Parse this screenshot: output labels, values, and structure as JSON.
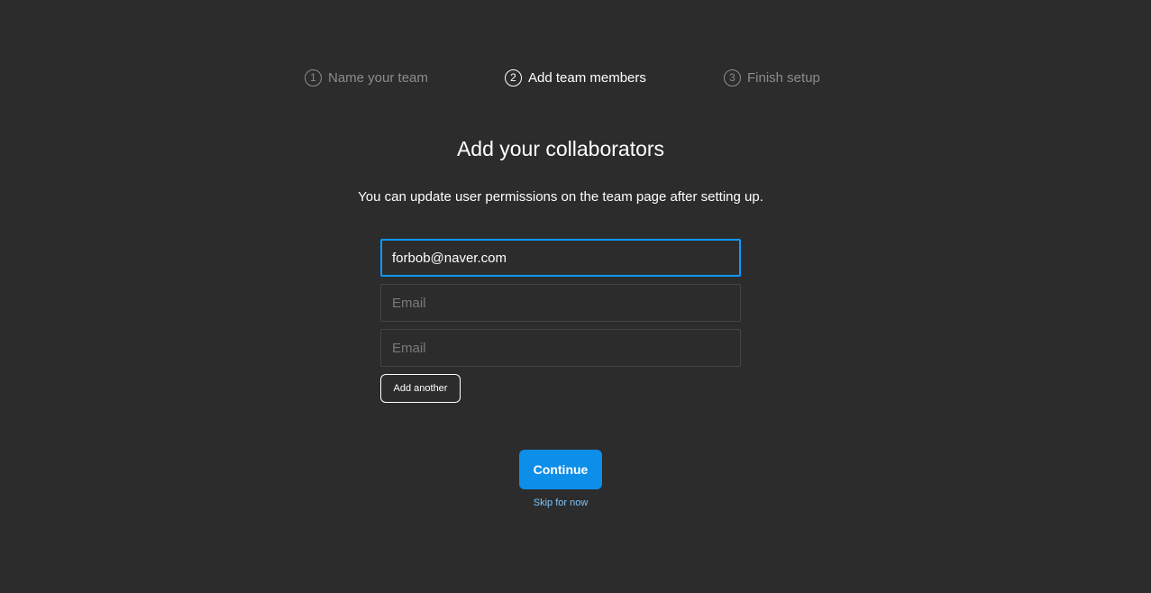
{
  "steps": [
    {
      "number": "1",
      "label": "Name your team",
      "state": "inactive"
    },
    {
      "number": "2",
      "label": "Add team members",
      "state": "active"
    },
    {
      "number": "3",
      "label": "Finish setup",
      "state": "inactive"
    }
  ],
  "heading": "Add your collaborators",
  "subheading": "You can update user permissions on the team page after setting up.",
  "emails": [
    {
      "value": "forbob@naver.com",
      "placeholder": "Email",
      "focused": true
    },
    {
      "value": "",
      "placeholder": "Email",
      "focused": false
    },
    {
      "value": "",
      "placeholder": "Email",
      "focused": false
    }
  ],
  "buttons": {
    "add_another": "Add another",
    "continue": "Continue",
    "skip": "Skip for now"
  },
  "colors": {
    "background": "#2c2c2c",
    "accent": "#0d8ee9",
    "focus_border": "#0d99ff",
    "link": "#7cc4fa",
    "inactive_text": "#8c8c8c"
  }
}
